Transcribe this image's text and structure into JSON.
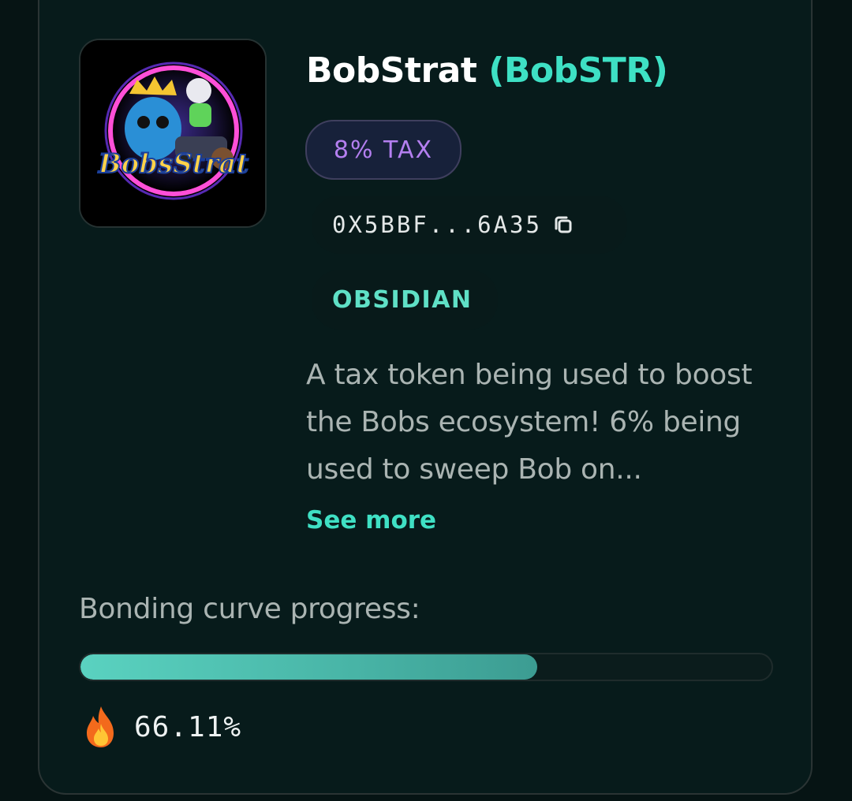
{
  "token": {
    "name": "BobStrat",
    "ticker": "(BobSTR)",
    "logo_text": "BobsStrat",
    "tax_badge": "8% TAX",
    "address": "0X5BBF...6A35",
    "platform": "OBSIDIAN",
    "description": "A tax token being used to boost the Bobs ecosystem! 6% being used to sweep Bob on...",
    "see_more": "See more"
  },
  "icons": {
    "copy": "copy-icon",
    "fire": "fire-icon"
  },
  "progress": {
    "label": "Bonding curve progress:",
    "percent_text": "66.11%",
    "value": 0.6611
  },
  "colors": {
    "accent": "#3ee0c4",
    "tax_purple": "#b47ff0",
    "background": "#071b1b"
  }
}
